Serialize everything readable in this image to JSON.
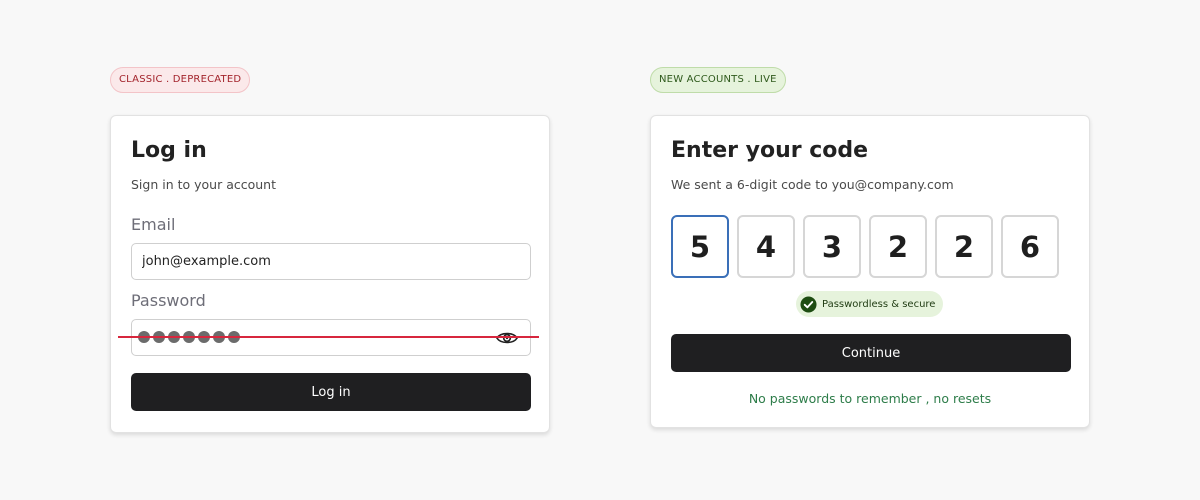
{
  "left_panel": {
    "badge": "CLASSIC . DEPRECATED",
    "title": "Log in",
    "subtitle": "Sign in to your account",
    "email_label": "Email",
    "email_value": "john@example.com",
    "password_label": "Password",
    "password_length": 7,
    "login_button": "Log in"
  },
  "right_panel": {
    "badge": "NEW ACCOUNTS . LIVE",
    "title": "Enter your code",
    "subtitle": "We sent a 6-digit code to you@company.com",
    "code_digits": [
      "5",
      "4",
      "3",
      "2",
      "2",
      "6"
    ],
    "secure_badge": "Passwordless & secure",
    "continue_button": "Continue",
    "footnote": "No passwords to remember , no resets"
  },
  "colors": {
    "deprecated": "#a3242c",
    "live": "#2f5a1c",
    "strike": "#d7263d",
    "active_digit_border": "#3a6fb8",
    "button": "#1f1f21",
    "footnote": "#2e7d4a"
  },
  "icons": [
    "eye-icon",
    "check-circle-icon"
  ]
}
